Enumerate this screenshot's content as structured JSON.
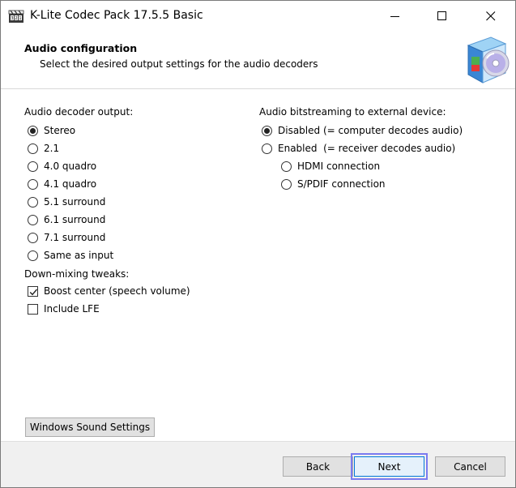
{
  "window": {
    "title": "K-Lite Codec Pack 17.5.5 Basic"
  },
  "header": {
    "title": "Audio configuration",
    "subtitle": "Select the desired output settings for the audio decoders"
  },
  "decoder_output": {
    "label": "Audio decoder output:",
    "options": [
      {
        "label": "Stereo",
        "selected": true
      },
      {
        "label": "2.1",
        "selected": false
      },
      {
        "label": "4.0 quadro",
        "selected": false
      },
      {
        "label": "4.1 quadro",
        "selected": false
      },
      {
        "label": "5.1 surround",
        "selected": false
      },
      {
        "label": "6.1 surround",
        "selected": false
      },
      {
        "label": "7.1 surround",
        "selected": false
      },
      {
        "label": "Same as input",
        "selected": false
      }
    ]
  },
  "downmix": {
    "label": "Down-mixing tweaks:",
    "options": [
      {
        "label": "Boost center (speech volume)",
        "checked": true
      },
      {
        "label": "Include LFE",
        "checked": false
      }
    ]
  },
  "bitstreaming": {
    "label": "Audio bitstreaming to external device:",
    "options": [
      {
        "label": "Disabled (= computer decodes audio)",
        "selected": true
      },
      {
        "label": "Enabled  (= receiver decodes audio)",
        "selected": false
      }
    ],
    "sub_options": [
      {
        "label": "HDMI connection",
        "selected": false
      },
      {
        "label": "S/PDIF connection",
        "selected": false
      }
    ]
  },
  "buttons": {
    "windows_sound": "Windows Sound Settings",
    "back": "Back",
    "next": "Next",
    "cancel": "Cancel"
  }
}
